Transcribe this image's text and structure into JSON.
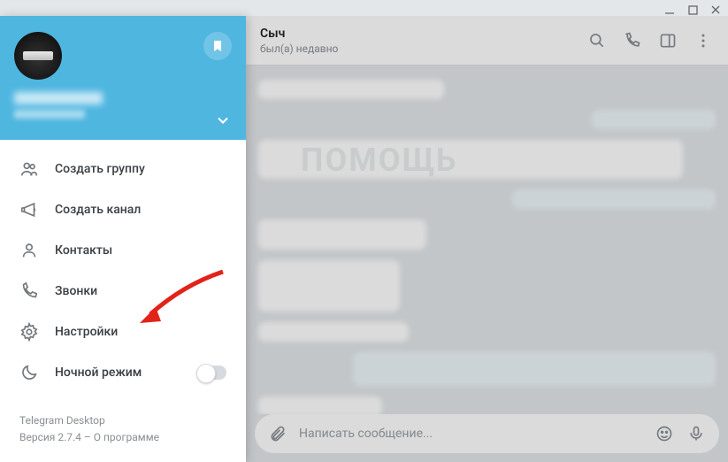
{
  "window": {
    "minimize": "—",
    "maximize": "□",
    "close": "×"
  },
  "chat": {
    "name": "Сыч",
    "status": "был(а) недавно"
  },
  "composer": {
    "placeholder": "Написать сообщение..."
  },
  "menu": {
    "items": [
      {
        "label": "Создать группу"
      },
      {
        "label": "Создать канал"
      },
      {
        "label": "Контакты"
      },
      {
        "label": "Звонки"
      },
      {
        "label": "Настройки"
      },
      {
        "label": "Ночной режим"
      }
    ]
  },
  "footer": {
    "app": "Telegram Desktop",
    "version_prefix": "Версия 2.7.4 – ",
    "about": "О программе"
  },
  "watermark": "ПОМОЩЬ"
}
